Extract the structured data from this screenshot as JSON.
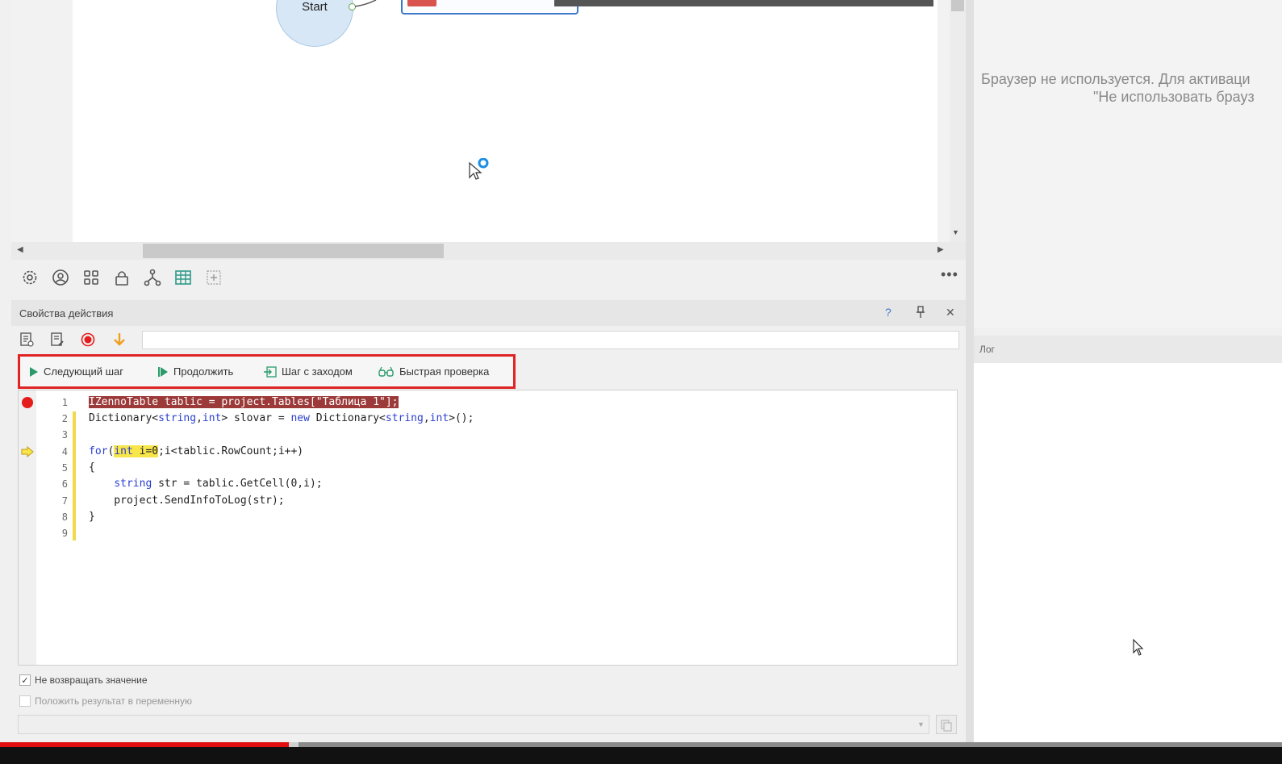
{
  "canvas": {
    "start_node_label": "Start"
  },
  "canvas_toolbar": {
    "icons": [
      "gear-icon",
      "user-circle-icon",
      "grid-icon",
      "lock-icon",
      "hierarchy-icon",
      "table-icon",
      "add-box-icon",
      "more-icon"
    ]
  },
  "properties_panel": {
    "title": "Свойства действия",
    "help_label": "?",
    "pin_label": "📌",
    "close_label": "✕",
    "input_value": "",
    "debug_toolbar": {
      "next_step": "Следующий шаг",
      "continue": "Продолжить",
      "step_into": "Шаг с заходом",
      "quick_check": "Быстрая проверка"
    },
    "code_lines": [
      {
        "no": "1",
        "text": "IZennoTable tablic = project.Tables[\"Таблица 1\"];"
      },
      {
        "no": "2",
        "text": "Dictionary<string,int> slovar = new Dictionary<string,int>();"
      },
      {
        "no": "3",
        "text": ""
      },
      {
        "no": "4",
        "text": "for(int i=0;i<tablic.RowCount;i++)"
      },
      {
        "no": "5",
        "text": "{"
      },
      {
        "no": "6",
        "text": "    string str = tablic.GetCell(0,i);"
      },
      {
        "no": "7",
        "text": "    project.SendInfoToLog(str);"
      },
      {
        "no": "8",
        "text": "}"
      },
      {
        "no": "9",
        "text": ""
      }
    ],
    "options": {
      "no_return_label": "Не возвращать значение",
      "no_return_checked": true,
      "put_result_label": "Положить результат в переменную",
      "put_result_checked": false
    },
    "result_variable": ""
  },
  "browser_pane": {
    "message_line1": "Браузер не используется. Для активаци",
    "message_line2": "\"Не использовать брауз"
  },
  "log_pane": {
    "title": "Лог"
  },
  "video_progress": {
    "played_fraction": 0.225
  },
  "colors": {
    "highlight_red": "#9c3a3a",
    "highlight_yellow": "#f7e54a",
    "keyword_blue": "#2a3fd1",
    "debug_frame": "#e02424",
    "progress_red": "#e10f0f"
  }
}
